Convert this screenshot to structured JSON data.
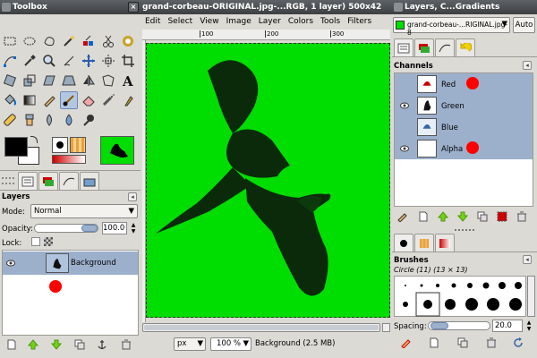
{
  "toolbox": {
    "title": "Toolbox",
    "close": "×"
  },
  "layers_panel": {
    "header": "Layers",
    "mode_label": "Mode:",
    "mode_value": "Normal",
    "opacity_label": "Opacity:",
    "opacity_value": "100.0",
    "lock_label": "Lock:",
    "layers": [
      {
        "name": "Background"
      }
    ]
  },
  "image_window": {
    "title": "grand-corbeau-ORIGINAL.jpg-...RGB, 1 layer) 500x42",
    "menus": [
      "Edit",
      "Select",
      "View",
      "Image",
      "Layer",
      "Colors",
      "Tools",
      "Filters"
    ],
    "ruler_ticks": [
      "100",
      "200",
      "300"
    ],
    "status": {
      "unit": "px",
      "zoom": "100 %",
      "info": "Background (2.5 MB)"
    }
  },
  "dock": {
    "title": "Layers, C...Gradients",
    "image_selector": "grand-corbeau-...RIGINAL.jpg-8",
    "auto_label": "Auto",
    "channels": {
      "header": "Channels",
      "items": [
        {
          "name": "Red"
        },
        {
          "name": "Green"
        },
        {
          "name": "Blue"
        },
        {
          "name": "Alpha"
        }
      ]
    },
    "brushes": {
      "header": "Brushes",
      "current": "Circle (11) (13 × 13)",
      "spacing_label": "Spacing:",
      "spacing_value": "20.0"
    }
  },
  "colors": {
    "canvas_green": "#00dd00",
    "selection_blue": "#9cb0cc",
    "red_marker": "#ff0000"
  }
}
